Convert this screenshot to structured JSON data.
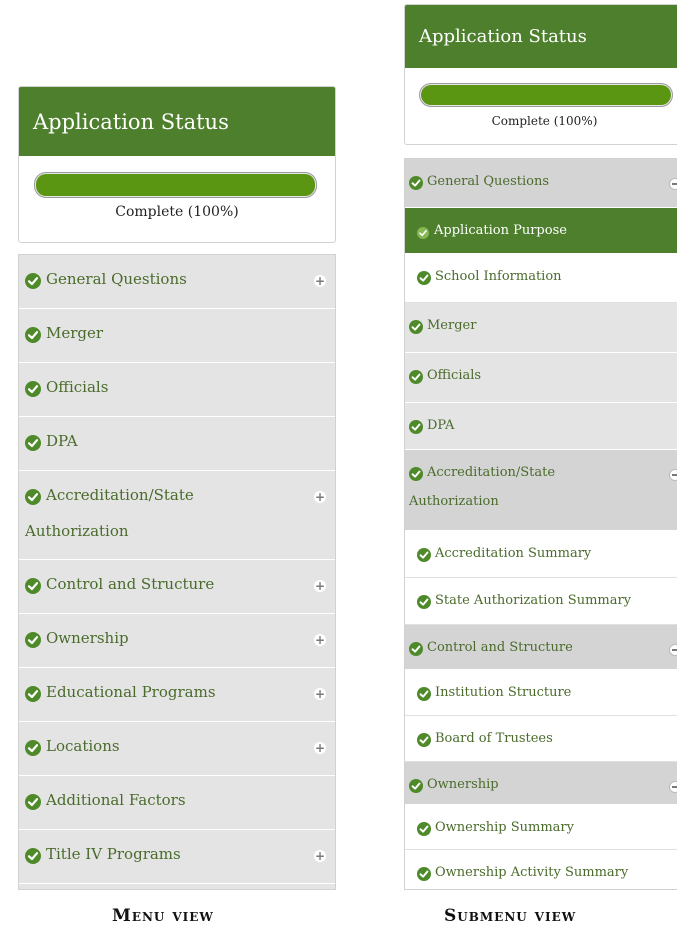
{
  "left": {
    "title": "Application Status",
    "progress_label": "Complete (100%)",
    "progress_value": 1.0,
    "items": [
      {
        "label": "General Questions",
        "expand": "+"
      },
      {
        "label": "Merger"
      },
      {
        "label": "Officials"
      },
      {
        "label": "DPA"
      },
      {
        "label": "Accreditation/State",
        "label2": "Authorization",
        "expand": "+"
      },
      {
        "label": "Control and Structure",
        "expand": "+"
      },
      {
        "label": "Ownership",
        "expand": "+"
      },
      {
        "label": "Educational Programs",
        "expand": "+"
      },
      {
        "label": "Locations",
        "expand": "+"
      },
      {
        "label": "Additional Factors"
      },
      {
        "label": "Title IV Programs",
        "expand": "+"
      }
    ]
  },
  "right": {
    "title": "Application Status",
    "progress_label": "Complete (100%)",
    "progress_value": 1.0,
    "items": [
      {
        "label": "General Questions",
        "type": "section"
      },
      {
        "label": "Application Purpose",
        "type": "active"
      },
      {
        "label": "School Information",
        "type": "sub"
      },
      {
        "label": "Merger",
        "type": "plain"
      },
      {
        "label": "Officials",
        "type": "plain"
      },
      {
        "label": "DPA",
        "type": "plain"
      },
      {
        "label": "Accreditation/State",
        "label2": "Authorization",
        "type": "section"
      },
      {
        "label": "Accreditation Summary",
        "type": "sub"
      },
      {
        "label": "State Authorization Summary",
        "type": "sub"
      },
      {
        "label": "Control and Structure",
        "type": "section"
      },
      {
        "label": "Institution Structure",
        "type": "sub"
      },
      {
        "label": "Board of Trustees",
        "type": "sub"
      },
      {
        "label": "Ownership",
        "type": "section"
      },
      {
        "label": "Ownership Summary",
        "type": "sub"
      },
      {
        "label": "Ownership Activity Summary",
        "type": "sub"
      }
    ]
  },
  "captions": {
    "menu_view": "Menu view",
    "submenu_view": "Submenu view"
  },
  "colors": {
    "header_green": "#4d7f2c",
    "progress_green": "#5b9612",
    "check_green": "#4f8a2a",
    "label_green": "#4a6b2b"
  }
}
